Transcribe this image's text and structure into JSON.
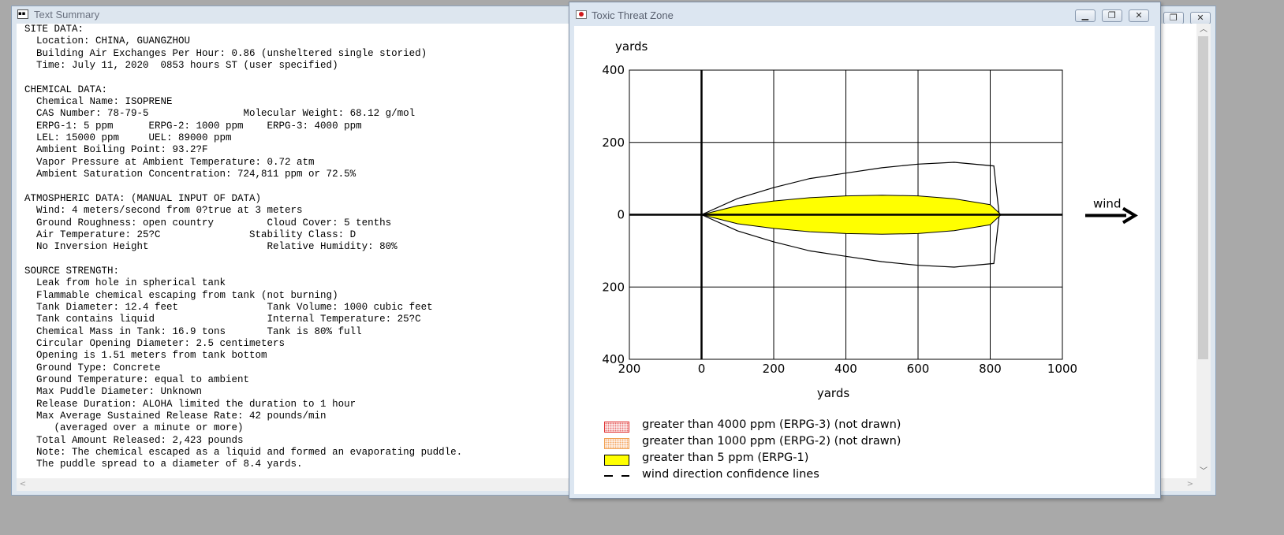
{
  "text_window": {
    "title": "Text Summary",
    "icon": "text-document-icon",
    "summary_lines": [
      "SITE DATA:",
      "  Location: CHINA, GUANGZHOU",
      "  Building Air Exchanges Per Hour: 0.86 (unsheltered single storied)",
      "  Time: July 11, 2020  0853 hours ST (user specified)",
      "",
      "CHEMICAL DATA:",
      "  Chemical Name: ISOPRENE",
      "  CAS Number: 78-79-5                Molecular Weight: 68.12 g/mol",
      "  ERPG-1: 5 ppm      ERPG-2: 1000 ppm    ERPG-3: 4000 ppm",
      "  LEL: 15000 ppm     UEL: 89000 ppm",
      "  Ambient Boiling Point: 93.2?F",
      "  Vapor Pressure at Ambient Temperature: 0.72 atm",
      "  Ambient Saturation Concentration: 724,811 ppm or 72.5%",
      "",
      "ATMOSPHERIC DATA: (MANUAL INPUT OF DATA)",
      "  Wind: 4 meters/second from 0?true at 3 meters",
      "  Ground Roughness: open country         Cloud Cover: 5 tenths",
      "  Air Temperature: 25?C               Stability Class: D",
      "  No Inversion Height                    Relative Humidity: 80%",
      "",
      "SOURCE STRENGTH:",
      "  Leak from hole in spherical tank",
      "  Flammable chemical escaping from tank (not burning)",
      "  Tank Diameter: 12.4 feet               Tank Volume: 1000 cubic feet",
      "  Tank contains liquid                   Internal Temperature: 25?C",
      "  Chemical Mass in Tank: 16.9 tons       Tank is 80% full",
      "  Circular Opening Diameter: 2.5 centimeters",
      "  Opening is 1.51 meters from tank bottom",
      "  Ground Type: Concrete",
      "  Ground Temperature: equal to ambient",
      "  Max Puddle Diameter: Unknown",
      "  Release Duration: ALOHA limited the duration to 1 hour",
      "  Max Average Sustained Release Rate: 42 pounds/min",
      "     (averaged over a minute or more)",
      "  Total Amount Released: 2,423 pounds",
      "  Note: The chemical escaped as a liquid and formed an evaporating puddle.",
      "  The puddle spread to a diameter of 8.4 yards."
    ]
  },
  "threat_window": {
    "title": "Toxic Threat Zone",
    "icon": "aloha-app-icon",
    "buttons": {
      "minimize": "minimize-icon",
      "restore": "restore-icon",
      "close": "close-icon"
    },
    "wind_label": "wind",
    "legend": [
      {
        "label": "greater than 4000 ppm (ERPG-3) (not drawn)",
        "swatch": "red-dotted",
        "color": "#e03030"
      },
      {
        "label": "greater than 1000 ppm (ERPG-2) (not drawn)",
        "swatch": "orange-dotted",
        "color": "#f4a460"
      },
      {
        "label": "greater than 5 ppm (ERPG-1)",
        "swatch": "yellow-solid",
        "color": "#ffff00"
      },
      {
        "label": "wind direction confidence lines",
        "swatch": "dashed-line",
        "color": "#000000"
      }
    ]
  },
  "chart_data": {
    "type": "area",
    "xlabel": "yards",
    "ylabel": "yards",
    "xlim": [
      -200,
      1000
    ],
    "ylim": [
      -400,
      400
    ],
    "x_ticks": [
      "200",
      "0",
      "200",
      "400",
      "600",
      "800",
      "1000"
    ],
    "y_ticks": [
      "400",
      "200",
      "0",
      "200",
      "400"
    ],
    "grid": true,
    "series": [
      {
        "name": "greater than 5 ppm (ERPG-1)",
        "fill": "#ffff00",
        "x": [
          0,
          100,
          200,
          300,
          400,
          500,
          600,
          700,
          800,
          830
        ],
        "y_half_width": [
          0,
          25,
          38,
          47,
          52,
          54,
          52,
          44,
          28,
          0
        ]
      },
      {
        "name": "wind direction confidence lines",
        "fill": "none",
        "x": [
          0,
          100,
          200,
          300,
          400,
          500,
          600,
          700,
          810,
          825
        ],
        "y_half_width": [
          0,
          45,
          75,
          100,
          115,
          130,
          140,
          145,
          135,
          0
        ]
      }
    ]
  }
}
